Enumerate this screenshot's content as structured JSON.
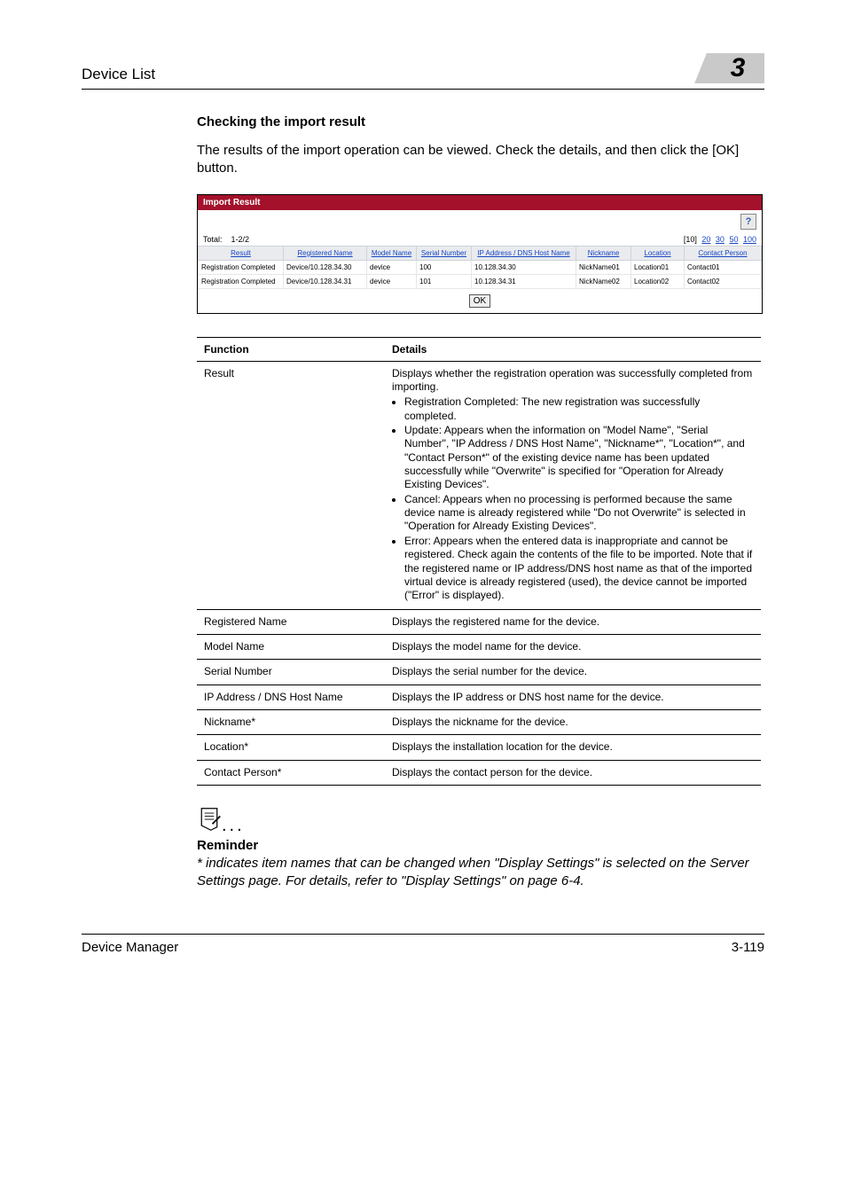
{
  "runhead": {
    "title": "Device List",
    "chapter": "3"
  },
  "section": {
    "heading": "Checking the import result",
    "intro": "The results of the import operation can be viewed. Check the details, and then click the [OK] button."
  },
  "shot": {
    "title": "Import Result",
    "total_label": "Total:",
    "total_value": "1-2/2",
    "pager_current": "[10]",
    "pager_links": [
      "20",
      "30",
      "50",
      "100"
    ],
    "columns": [
      "Result",
      "Registered Name",
      "Model Name",
      "Serial Number",
      "IP Address / DNS Host Name",
      "Nickname",
      "Location",
      "Contact Person"
    ],
    "rows": [
      {
        "result": "Registration Completed",
        "regname": "Device/10.128.34.30",
        "model": "device",
        "serial": "100",
        "ip": "10.128.34.30",
        "nick": "NickName01",
        "loc": "Location01",
        "contact": "Contact01"
      },
      {
        "result": "Registration Completed",
        "regname": "Device/10.128.34.31",
        "model": "device",
        "serial": "101",
        "ip": "10.128.34.31",
        "nick": "NickName02",
        "loc": "Location02",
        "contact": "Contact02"
      }
    ],
    "ok": "OK",
    "help": "?"
  },
  "table": {
    "head_func": "Function",
    "head_det": "Details",
    "rows": {
      "result": {
        "f": "Result",
        "lead": "Displays whether the registration operation was successfully completed from importing.",
        "b1": "Registration Completed: The new registration was successfully completed.",
        "b2": "Update: Appears when the information on \"Model Name\", \"Serial Number\", \"IP Address / DNS Host Name\", \"Nickname*\", \"Location*\", and \"Contact Person*\" of the existing device name has been updated successfully while \"Overwrite\" is specified for \"Operation for Already Existing Devices\".",
        "b3": "Cancel: Appears when no processing is performed because the same device name is already registered while \"Do not Overwrite\" is selected in \"Operation for Already Existing Devices\".",
        "b4": "Error: Appears when the entered data is inappropriate and cannot be registered. Check again the contents of the file to be imported. Note that if the registered name or IP address/DNS host name as that of the imported virtual device is already registered (used), the device cannot be imported (\"Error\" is displayed)."
      },
      "regname": {
        "f": "Registered Name",
        "d": "Displays the registered name for the device."
      },
      "model": {
        "f": "Model Name",
        "d": "Displays the model name for the device."
      },
      "serial": {
        "f": "Serial Number",
        "d": "Displays the serial number for the device."
      },
      "ip": {
        "f": "IP Address / DNS Host Name",
        "d": "Displays the IP address or DNS host name for the device."
      },
      "nick": {
        "f": "Nickname*",
        "d": "Displays the nickname for the device."
      },
      "loc": {
        "f": "Location*",
        "d": "Displays the installation location for the device."
      },
      "contact": {
        "f": "Contact Person*",
        "d": "Displays the contact person for the device."
      }
    }
  },
  "reminder": {
    "heading": "Reminder",
    "body": "* indicates item names that can be changed when \"Display Settings\" is selected on the Server Settings page. For details, refer to \"Display Settings\" on page 6-4."
  },
  "footer": {
    "left": "Device Manager",
    "right": "3-119"
  },
  "chart_data": null
}
